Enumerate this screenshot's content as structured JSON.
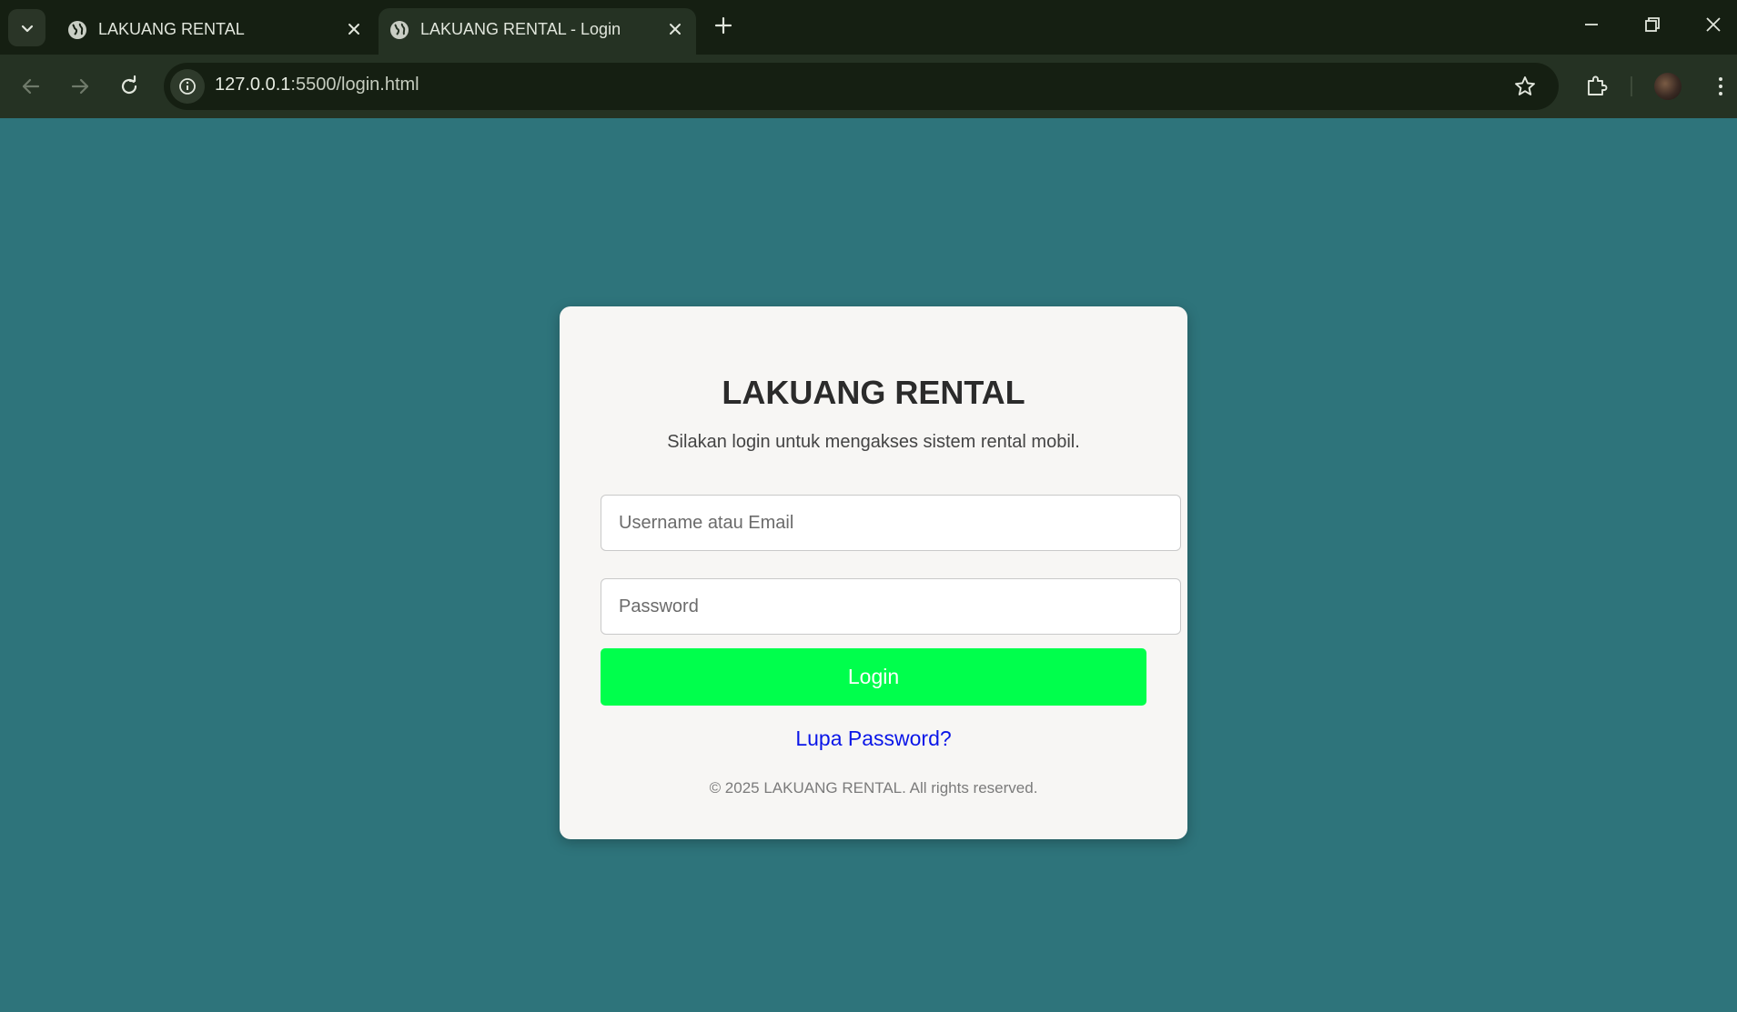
{
  "browser": {
    "tabs": [
      {
        "title": "LAKUANG RENTAL",
        "active": false,
        "icon": "globe-icon"
      },
      {
        "title": "LAKUANG RENTAL - Login",
        "active": true,
        "icon": "globe-icon"
      }
    ],
    "url_host": "127.0.0.1",
    "url_rest": ":5500/login.html",
    "colors": {
      "tabbar": "#151f12",
      "toolbar": "#253223",
      "page_bg": "#2e747b"
    }
  },
  "login": {
    "title": "LAKUANG RENTAL",
    "subtitle": "Silakan login untuk mengakses sistem rental mobil.",
    "username_placeholder": "Username atau Email",
    "username_value": "",
    "password_placeholder": "Password",
    "password_value": "",
    "button_label": "Login",
    "forgot_label": "Lupa Password?",
    "footer": "© 2025 LAKUANG RENTAL. All rights reserved.",
    "colors": {
      "button": "#00ff4c",
      "link": "#0a16e8",
      "card": "#f7f6f4"
    }
  }
}
